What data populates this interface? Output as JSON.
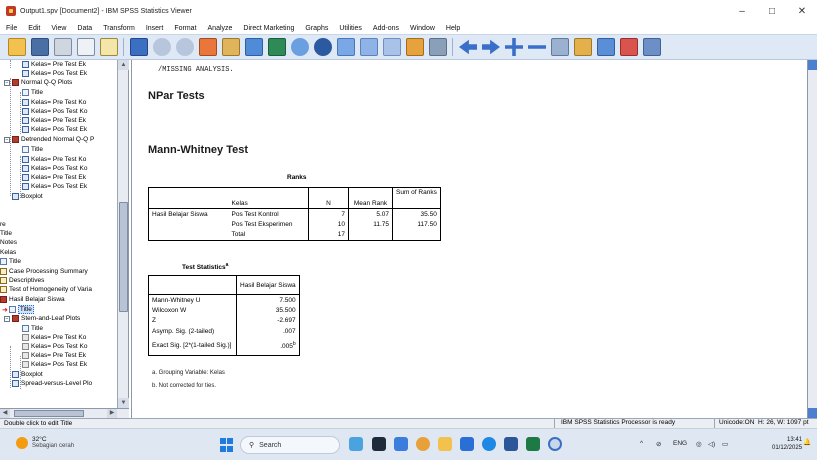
{
  "window": {
    "title": "Output1.spv [Document2] - IBM SPSS Statistics Viewer",
    "minimize": "–",
    "maximize": "□",
    "close": "✕"
  },
  "menu": [
    "File",
    "Edit",
    "View",
    "Data",
    "Transform",
    "Insert",
    "Format",
    "Analyze",
    "Direct Marketing",
    "Graphs",
    "Utilities",
    "Add-ons",
    "Window",
    "Help"
  ],
  "nav": {
    "items": [
      {
        "text": "Kelas= Pre Test Ek",
        "icon": "chart-icon"
      },
      {
        "text": "Kelas= Pos Test Ek",
        "icon": "chart-icon"
      },
      {
        "text": "Normal Q-Q Plots",
        "icon": "book-icon"
      },
      {
        "text": "Title",
        "icon": "title-icon"
      },
      {
        "text": "Kelas= Pre Test Ko",
        "icon": "chart-icon"
      },
      {
        "text": "Kelas= Pos Test Ko",
        "icon": "chart-icon"
      },
      {
        "text": "Kelas= Pre Test Ek",
        "icon": "chart-icon"
      },
      {
        "text": "Kelas= Pos Test Ek",
        "icon": "chart-icon"
      },
      {
        "text": "Detrended Normal Q-Q P",
        "icon": "book-icon"
      },
      {
        "text": "Title",
        "icon": "title-icon"
      },
      {
        "text": "Kelas= Pre Test Ko",
        "icon": "chart-icon"
      },
      {
        "text": "Kelas= Pos Test Ko",
        "icon": "chart-icon"
      },
      {
        "text": "Kelas= Pre Test Ek",
        "icon": "chart-icon"
      },
      {
        "text": "Kelas= Pos Test Ek",
        "icon": "chart-icon"
      },
      {
        "text": "Boxplot",
        "icon": "chart-icon"
      },
      {
        "text": "re",
        "icon": ""
      },
      {
        "text": "Title",
        "icon": ""
      },
      {
        "text": "Notes",
        "icon": ""
      },
      {
        "text": "Kelas",
        "icon": ""
      },
      {
        "text": "Title",
        "icon": "title-icon"
      },
      {
        "text": "Case Processing Summary",
        "icon": "table-icon"
      },
      {
        "text": "Descriptives",
        "icon": "table-icon"
      },
      {
        "text": "Test of Homogeneity of Varia",
        "icon": "table-icon"
      },
      {
        "text": "Hasil Belajar Siswa",
        "icon": "book-icon"
      },
      {
        "text": "Title",
        "icon": "title-icon"
      },
      {
        "text": "Stem-and-Leaf Plots",
        "icon": "book-icon"
      },
      {
        "text": "Title",
        "icon": "title-icon"
      },
      {
        "text": "Kelas= Pre Test Ko",
        "icon": "log-icon"
      },
      {
        "text": "Kelas= Pos Test Ko",
        "icon": "log-icon"
      },
      {
        "text": "Kelas= Pre Test Ek",
        "icon": "log-icon"
      },
      {
        "text": "Kelas= Pos Test Ek",
        "icon": "log-icon"
      },
      {
        "text": "Boxplot",
        "icon": "chart-icon"
      },
      {
        "text": "Spread-versus-Level Plo",
        "icon": "chart-icon"
      }
    ]
  },
  "output": {
    "syntax": "/MISSING ANALYSIS.",
    "heading_npar": "NPar Tests",
    "heading_mw": "Mann-Whitney Test",
    "ranks": {
      "caption": "Ranks",
      "headers": [
        "Kelas",
        "N",
        "Mean Rank",
        "Sum of Ranks"
      ],
      "var": "Hasil Belajar Siswa",
      "rows": [
        {
          "group": "Pos Test Kontrol",
          "n": "7",
          "mean": "5.07",
          "sum": "35.50"
        },
        {
          "group": "Pos Test Eksperimen",
          "n": "10",
          "mean": "11.75",
          "sum": "117.50"
        },
        {
          "group": "Total",
          "n": "17",
          "mean": "",
          "sum": ""
        }
      ]
    },
    "stats": {
      "caption": "Test Statistics",
      "caption_sup": "a",
      "col_header": "Hasil Belajar Siswa",
      "rows": [
        {
          "label": "Mann-Whitney U",
          "value": "7.500",
          "sup": ""
        },
        {
          "label": "Wilcoxon W",
          "value": "35.500",
          "sup": ""
        },
        {
          "label": "Z",
          "value": "-2.697",
          "sup": ""
        },
        {
          "label": "Asymp. Sig. (2-tailed)",
          "value": ".007",
          "sup": ""
        },
        {
          "label": "Exact Sig. [2*(1-tailed Sig.)]",
          "value": ".005",
          "sup": "b"
        }
      ],
      "footnotes": [
        "a. Grouping Variable: Kelas",
        "b. Not corrected for ties."
      ]
    }
  },
  "status": {
    "hint": "Double click to edit Title",
    "processor": "IBM SPSS Statistics Processor is ready",
    "unicode": "Unicode:ON",
    "dims": "H: 26, W: 1097 pt"
  },
  "taskbar": {
    "temp": "32°C",
    "weather": "Sebagian cerah",
    "search": "Search",
    "lang": "ENG",
    "time": "13:41",
    "date": "01/12/2025"
  },
  "colors": {
    "toolbar_bg": "#dfe9f6",
    "accent_blue": "#4d7fd0",
    "spss_red": "#b23b2e"
  }
}
